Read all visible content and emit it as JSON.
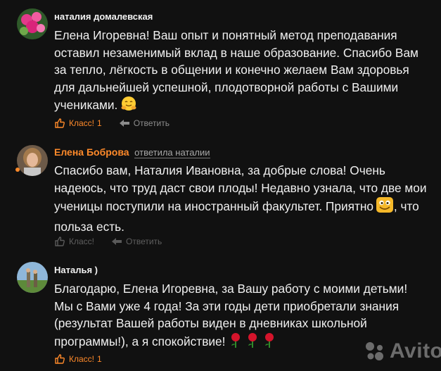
{
  "comments": [
    {
      "author": "наталия домалевская",
      "text": "Елена Игоревна! Ваш опыт и понятный метод преподавания оставил незаменимый вклад в наше образование. Спасибо Вам за тепло, лёгкость в общении и конечно желаем Вам здоровья для дальнейшей успешной, плодотворной работы с Вашими учениками.",
      "emoji": "hugging-face-emoji",
      "like_label": "Класс!",
      "like_count": "1",
      "reply_label": "Ответить"
    },
    {
      "author": "Елена Боброва",
      "reply_to": "ответила наталии",
      "text_before": "Спасибо вам, Наталия Ивановна, за добрые слова! Очень надеюсь, что труд даст свои плоды! Недавно узнала, что две мои ученицы поступили на иностранный факультет. Приятно",
      "text_after": ", что польза есть.",
      "emoji": "happy-face-emoji",
      "like_label": "Класс!",
      "reply_label": "Ответить"
    },
    {
      "author": "Наталья )",
      "text": "Благодарю, Елена Игоревна, за Вашу работу с моими детьми! Мы с Вами уже 4 года! За эти годы дети приобретали знания (результат Вашей работы виден в дневниках школьной программы!), а я спокойствие!",
      "emoji": "rose-emoji",
      "like_label": "Класс!",
      "like_count": "1"
    }
  ],
  "watermark": "Avito",
  "colors": {
    "accent": "#ff8a2a",
    "background": "#111111",
    "muted": "#8c8c8c"
  }
}
